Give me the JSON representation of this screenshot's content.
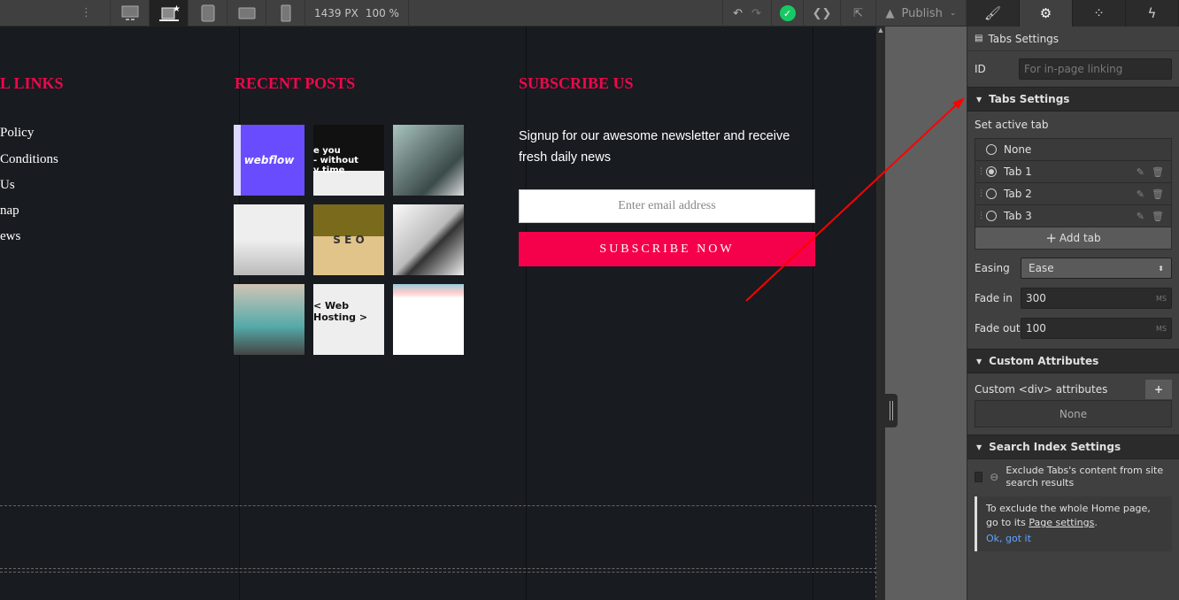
{
  "toolbar": {
    "width": "1439 PX",
    "zoom": "100 %",
    "publish": "Publish",
    "devices": [
      "desktop-icon",
      "laptop-icon",
      "tablet-icon",
      "mobile-landscape-icon",
      "mobile-portrait-icon"
    ]
  },
  "canvas": {
    "links_heading": "L  LINKS",
    "links": [
      "Policy",
      " Conditions",
      "Us",
      "nap",
      "ews"
    ],
    "posts_heading": "RECENT POSTS",
    "thumb_texts": [
      "webflow",
      "e you\n- without\nv time",
      "",
      "",
      "S E O",
      "",
      "",
      "< Web Hosting >",
      ""
    ],
    "subscribe_heading": "SUBSCRIBE US",
    "subscribe_text": "Signup for our awesome newsletter and receive fresh daily news",
    "email_placeholder": "Enter email address",
    "subscribe_button": "SUBSCRIBE NOW"
  },
  "panel": {
    "title": "Tabs Settings",
    "id_label": "ID",
    "id_placeholder": "For in-page linking",
    "tabs_section": "Tabs Settings",
    "set_active": "Set active tab",
    "tabs": [
      {
        "label": "None",
        "active": false
      },
      {
        "label": "Tab 1",
        "active": true
      },
      {
        "label": "Tab 2",
        "active": false
      },
      {
        "label": "Tab 3",
        "active": false
      }
    ],
    "add_tab": "Add tab",
    "easing_label": "Easing",
    "easing": "Ease",
    "fade_in_label": "Fade in",
    "fade_in": "300",
    "fade_out_label": "Fade out",
    "fade_out": "100",
    "unit": "MS",
    "custom_section": "Custom Attributes",
    "custom_label": "Custom <div> attributes",
    "custom_none": "None",
    "search_section": "Search Index Settings",
    "exclude_label": "Exclude Tabs's content from site search results",
    "note_pre": "To exclude the whole Home page, go to its ",
    "note_link": "Page settings",
    "note_post": ".",
    "ok": "Ok, got it"
  },
  "colors": {
    "accent": "#f0074b",
    "success": "#17c964",
    "annotation": "#ff0000"
  }
}
